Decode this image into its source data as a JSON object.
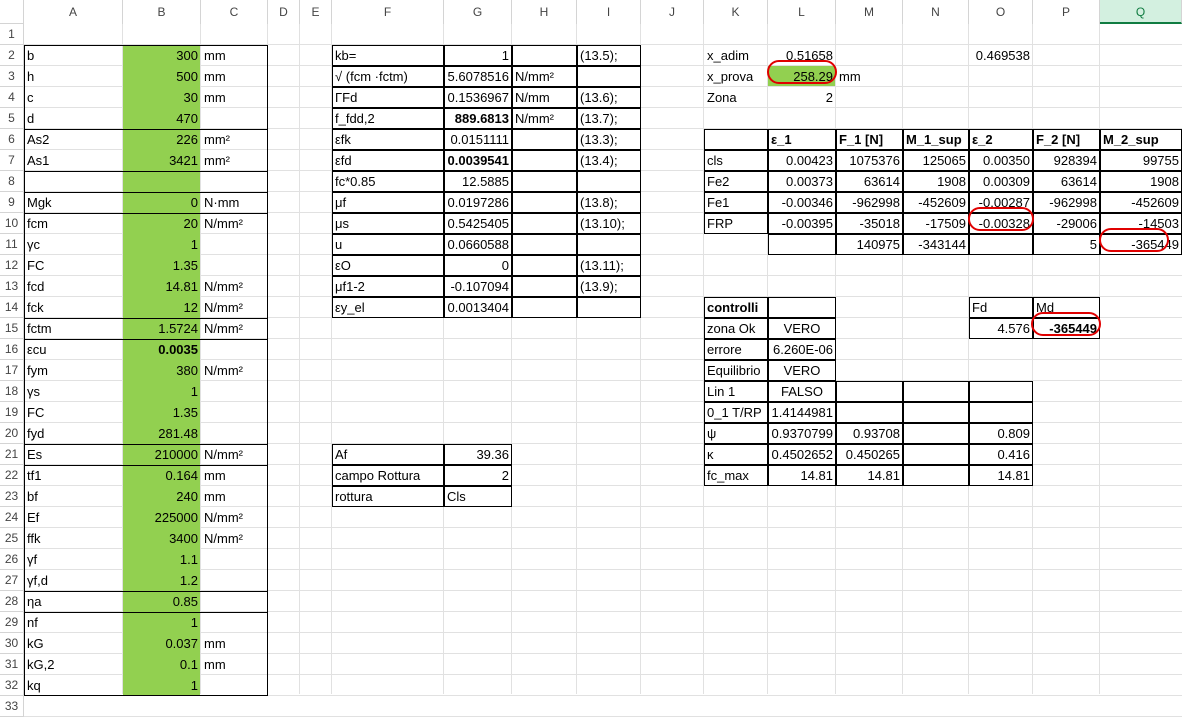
{
  "columns": [
    "A",
    "B",
    "C",
    "D",
    "E",
    "F",
    "G",
    "H",
    "I",
    "J",
    "K",
    "L",
    "M",
    "N",
    "O",
    "P",
    "Q"
  ],
  "selected_column": "Q",
  "rows": [
    "1",
    "2",
    "3",
    "4",
    "5",
    "6",
    "7",
    "8",
    "9",
    "10",
    "11",
    "12",
    "13",
    "14",
    "15",
    "16",
    "17",
    "18",
    "19",
    "20",
    "21",
    "22",
    "23",
    "24",
    "25",
    "26",
    "27",
    "28",
    "29",
    "30",
    "31",
    "32",
    "33"
  ],
  "colors": {
    "input_fill": "#92d050",
    "highlight_oval": "#e00000",
    "selected_header": "#107c41"
  },
  "input_params": [
    {
      "name": "b",
      "value": "300",
      "unit": "mm"
    },
    {
      "name": "h",
      "value": "500",
      "unit": "mm"
    },
    {
      "name": "c",
      "value": "30",
      "unit": "mm"
    },
    {
      "name": "d",
      "value": "470",
      "unit": ""
    },
    {
      "name": "As2",
      "value": "226",
      "unit": "mm²"
    },
    {
      "name": "As1",
      "value": "3421",
      "unit": "mm²"
    },
    {
      "name": "",
      "value": "",
      "unit": ""
    },
    {
      "name": "Mgk",
      "value": "0",
      "unit": "N·mm"
    },
    {
      "name": "fcm",
      "value": "20",
      "unit": "N/mm²"
    },
    {
      "name": "γc",
      "value": "1",
      "unit": ""
    },
    {
      "name": "FC",
      "value": "1.35",
      "unit": ""
    },
    {
      "name": "fcd",
      "value": "14.81",
      "unit": "N/mm²"
    },
    {
      "name": "fck",
      "value": "12",
      "unit": "N/mm²"
    },
    {
      "name": "fctm",
      "value": "1.5724",
      "unit": "N/mm²"
    },
    {
      "name": "εcu",
      "value": "0.0035",
      "unit": ""
    },
    {
      "name": "fym",
      "value": "380",
      "unit": "N/mm²"
    },
    {
      "name": "γs",
      "value": "1",
      "unit": ""
    },
    {
      "name": "FC",
      "value": "1.35",
      "unit": ""
    },
    {
      "name": "fyd",
      "value": "281.48",
      "unit": ""
    },
    {
      "name": "Es",
      "value": "210000",
      "unit": "N/mm²"
    },
    {
      "name": "tf1",
      "value": "0.164",
      "unit": "mm"
    },
    {
      "name": "bf",
      "value": "240",
      "unit": "mm"
    },
    {
      "name": "Ef",
      "value": "225000",
      "unit": "N/mm²"
    },
    {
      "name": "ffk",
      "value": "3400",
      "unit": "N/mm²"
    },
    {
      "name": "γf",
      "value": "1.1",
      "unit": ""
    },
    {
      "name": "γf,d",
      "value": "1.2",
      "unit": ""
    },
    {
      "name": "ηa",
      "value": "0.85",
      "unit": ""
    },
    {
      "name": "nf",
      "value": "1",
      "unit": ""
    },
    {
      "name": "kG",
      "value": "0.037",
      "unit": "mm"
    },
    {
      "name": "kG,2",
      "value": "0.1",
      "unit": "mm"
    },
    {
      "name": "kq",
      "value": "1",
      "unit": ""
    }
  ],
  "frp_params": [
    {
      "name": "kb=",
      "value": "1",
      "unit": "",
      "ref": "(13.5);"
    },
    {
      "name": "√ (fcm ·fctm)",
      "value": "5.6078516",
      "unit": "N/mm²",
      "ref": ""
    },
    {
      "name": "ΓFd",
      "value": "0.1536967",
      "unit": "N/mm",
      "ref": "(13.6);"
    },
    {
      "name": "f_fdd,2",
      "value": "889.6813",
      "unit": "N/mm²",
      "ref": "(13.7);"
    },
    {
      "name": "εfk",
      "value": "0.0151111",
      "unit": "",
      "ref": "(13.3);"
    },
    {
      "name": "εfd",
      "value": "0.0039541",
      "unit": "",
      "ref": "(13.4);"
    },
    {
      "name": "fc*0.85",
      "value": "12.5885",
      "unit": "",
      "ref": ""
    },
    {
      "name": "μf",
      "value": "0.0197286",
      "unit": "",
      "ref": "(13.8);"
    },
    {
      "name": "μs",
      "value": "0.5425405",
      "unit": "",
      "ref": "(13.10);"
    },
    {
      "name": "u",
      "value": "0.0660588",
      "unit": "",
      "ref": ""
    },
    {
      "name": "εO",
      "value": "0",
      "unit": "",
      "ref": "(13.11);"
    },
    {
      "name": "μf1-2",
      "value": "-0.107094",
      "unit": "",
      "ref": "(13.9);"
    },
    {
      "name": "εy_el",
      "value": "0.0013404",
      "unit": "",
      "ref": ""
    }
  ],
  "af_block": [
    {
      "name": "Af",
      "value": "39.36"
    },
    {
      "name": "campo Rottura",
      "value": "2"
    },
    {
      "name": "rottura",
      "value": "Cls"
    }
  ],
  "top_right": {
    "x_adim_label": "x_adim",
    "x_adim_value": "0.51658",
    "x_adim_o": "0.469538",
    "x_prova_label": "x_prova",
    "x_prova_value": "258.29",
    "x_prova_unit": "mm",
    "zona_label": "Zona",
    "zona_value": "2"
  },
  "results_table": {
    "headers": [
      "",
      "ε_1",
      "F_1 [N]",
      "M_1_sup",
      "ε_2",
      "F_2  [N]",
      "M_2_sup"
    ],
    "rows": [
      [
        "cls",
        "0.00423",
        "1075376",
        "125065",
        "0.00350",
        "928394",
        "99755"
      ],
      [
        "Fe2",
        "0.00373",
        "63614",
        "1908",
        "0.00309",
        "63614",
        "1908"
      ],
      [
        "Fe1",
        "-0.00346",
        "-962998",
        "-452609",
        "-0.00287",
        "-962998",
        "-452609"
      ],
      [
        "FRP",
        "-0.00395",
        "-35018",
        "-17509",
        "-0.00328",
        "-29006",
        "-14503"
      ]
    ],
    "totals": [
      "",
      "",
      "140975",
      "-343144",
      "",
      "5",
      "-365449"
    ]
  },
  "controlli": {
    "title": "controlli",
    "rows": [
      {
        "label": "zona Ok",
        "value": "VERO"
      },
      {
        "label": "errore",
        "value": "6.260E-06"
      },
      {
        "label": "Equilibrio",
        "value": "VERO"
      }
    ],
    "fd_label": "Fd",
    "fd_value": "4.576",
    "md_label": "Md",
    "md_value": "-365449"
  },
  "lin_table": {
    "rows": [
      [
        "Lin 1",
        "FALSO",
        "",
        "",
        ""
      ],
      [
        "0_1 T/RP",
        "1.4144981",
        "",
        "",
        ""
      ],
      [
        "ψ",
        "0.9370799",
        "0.93708",
        "",
        "0.809"
      ],
      [
        "κ",
        "0.4502652",
        "0.450265",
        "",
        "0.416"
      ],
      [
        "fc_max",
        "14.81",
        "14.81",
        "",
        "14.81"
      ]
    ]
  }
}
